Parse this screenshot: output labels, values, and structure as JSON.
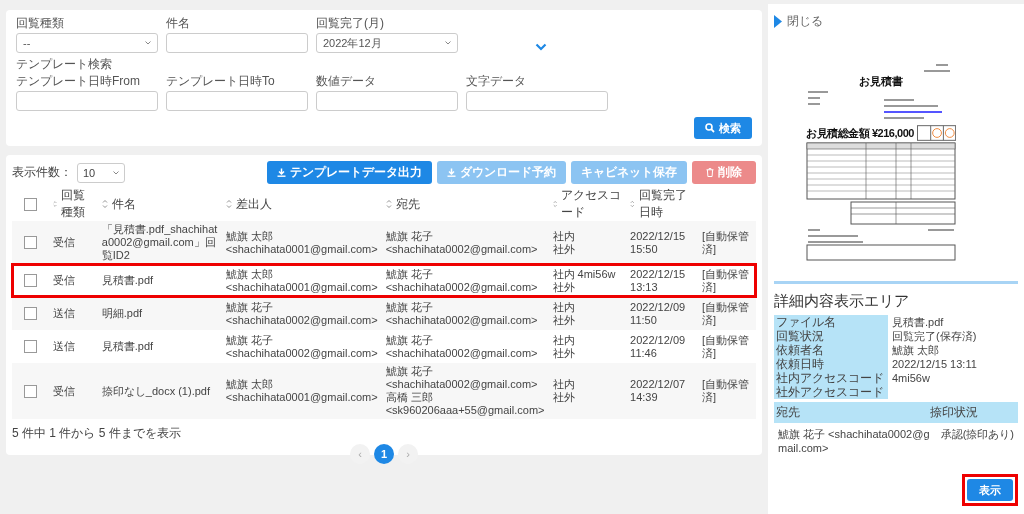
{
  "search_form": {
    "fields": [
      {
        "label": "回覧種類",
        "kind": "select",
        "value": "--"
      },
      {
        "label": "件名",
        "kind": "text"
      },
      {
        "label": "回覧完了(月)",
        "kind": "select",
        "value": "2022年12月"
      }
    ],
    "section_label": "テンプレート検索",
    "template_fields": [
      {
        "label": "テンプレート日時From"
      },
      {
        "label": "テンプレート日時To"
      },
      {
        "label": "数値データ"
      },
      {
        "label": "文字データ"
      }
    ],
    "search_button": "検索"
  },
  "toolbar": {
    "page_size_label": "表示件数：",
    "page_size": "10",
    "buttons": [
      {
        "label": "テンプレートデータ出力",
        "kind": "download",
        "disabled": false
      },
      {
        "label": "ダウンロード予約",
        "kind": "download",
        "disabled": true
      },
      {
        "label": "キャビネット保存",
        "kind": "plain",
        "disabled": true
      },
      {
        "label": "削除",
        "kind": "delete",
        "disabled": true
      }
    ]
  },
  "table": {
    "all_checked": false,
    "columns": [
      "回覧種類",
      "件名",
      "差出人",
      "宛先",
      "アクセスコード",
      "回覧完了日時"
    ],
    "rows": [
      {
        "checked": false,
        "highlighted": false,
        "type": "受信",
        "subject": "「見積書.pdf_shachihata0002@gmail.com」回覧ID2",
        "sender_name": "鯱旗 太郎",
        "sender_email": "<shachihata0001@gmail.com>",
        "recipients": [
          "鯱旗 花子 <shachihata0002@gmail.com>"
        ],
        "access_internal": "社内",
        "access_external": "社外",
        "completed": "2022/12/15 15:50",
        "status": "[自動保管済]"
      },
      {
        "checked": false,
        "highlighted": true,
        "type": "受信",
        "subject": "見積書.pdf",
        "sender_name": "鯱旗 太郎",
        "sender_email": "<shachihata0001@gmail.com>",
        "recipients": [
          "鯱旗 花子 <shachihata0002@gmail.com>"
        ],
        "access_internal": "社内 4mi56w",
        "access_external": "社外",
        "completed": "2022/12/15 13:13",
        "status": "[自動保管済]"
      },
      {
        "checked": false,
        "highlighted": false,
        "type": "送信",
        "subject": "明細.pdf",
        "sender_name": "鯱旗 花子",
        "sender_email": "<shachihata0002@gmail.com>",
        "recipients": [
          "鯱旗 花子 <shachihata0002@gmail.com>"
        ],
        "access_internal": "社内",
        "access_external": "社外",
        "completed": "2022/12/09 11:50",
        "status": "[自動保管済]"
      },
      {
        "checked": false,
        "highlighted": false,
        "type": "送信",
        "subject": "見積書.pdf",
        "sender_name": "鯱旗 花子",
        "sender_email": "<shachihata0002@gmail.com>",
        "recipients": [
          "鯱旗 花子 <shachihata0002@gmail.com>"
        ],
        "access_internal": "社内",
        "access_external": "社外",
        "completed": "2022/12/09 11:46",
        "status": "[自動保管済]"
      },
      {
        "checked": false,
        "highlighted": false,
        "type": "受信",
        "subject": "捺印なし_docx (1).pdf",
        "sender_name": "鯱旗 太郎",
        "sender_email": "<shachihata0001@gmail.com>",
        "recipients": [
          "鯱旗 花子 <shachihata0002@gmail.com>",
          "高橋 三郎 <sk960206aaa+55@gmail.com>"
        ],
        "access_internal": "社内",
        "access_external": "社外",
        "completed": "2022/12/07 14:39",
        "status": "[自動保管済]"
      }
    ]
  },
  "summary": "5 件中 1 件から 5 件までを表示",
  "pagination": {
    "prev": "‹",
    "next": "›",
    "pages": [
      {
        "label": "1",
        "selected": true
      }
    ]
  },
  "side_panel": {
    "close_label": "閉じる",
    "document": {
      "title": "お見積書",
      "total_label": "お見積総金額",
      "total_amount": "¥216,000"
    },
    "detail_title": "詳細内容表示エリア",
    "details": [
      {
        "label": "ファイル名",
        "value": "見積書.pdf"
      },
      {
        "label": "回覧状況",
        "value": "回覧完了(保存済)"
      },
      {
        "label": "依頼者名",
        "value": "鯱旗 太郎"
      },
      {
        "label": "依頼日時",
        "value": "2022/12/15 13:11"
      },
      {
        "label": "社内アクセスコード",
        "value": "4mi56w"
      },
      {
        "label": "社外アクセスコード"
      }
    ],
    "recipients_header": [
      "宛先",
      "捺印状況"
    ],
    "recipients": [
      {
        "name": "鯱旗 花子 <shachihata0002@gmail.com>",
        "status": "承認(捺印あり)"
      }
    ],
    "show_button": {
      "label": "表示",
      "highlighted": true
    }
  }
}
